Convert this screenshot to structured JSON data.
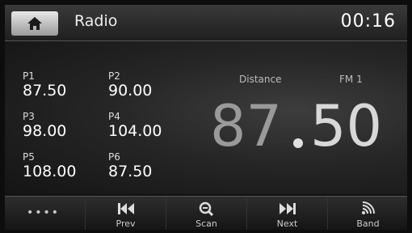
{
  "header": {
    "title": "Radio",
    "time": "00:16"
  },
  "presets": [
    {
      "name": "P1",
      "freq": "87.50"
    },
    {
      "name": "P2",
      "freq": "90.00"
    },
    {
      "name": "P3",
      "freq": "98.00"
    },
    {
      "name": "P4",
      "freq": "104.00"
    },
    {
      "name": "P5",
      "freq": "108.00"
    },
    {
      "name": "P6",
      "freq": "87.50"
    }
  ],
  "tuner": {
    "distance_label": "Distance",
    "band": "FM 1",
    "freq_int": "87",
    "freq_dec": "50"
  },
  "footer": {
    "more": "••••",
    "prev": "Prev",
    "scan": "Scan",
    "next": "Next",
    "band": "Band"
  }
}
